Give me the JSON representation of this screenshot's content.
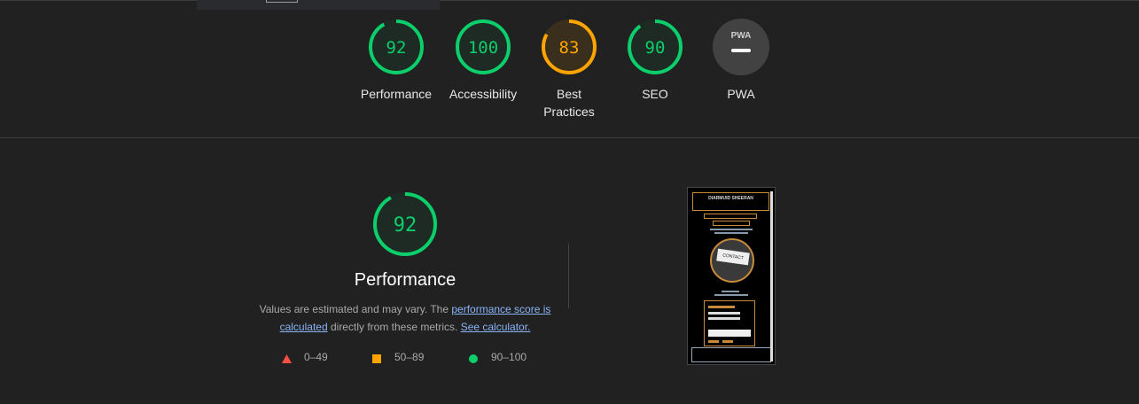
{
  "categories": [
    {
      "label": "Performance",
      "score": 92,
      "status": "pass"
    },
    {
      "label": "Accessibility",
      "score": 100,
      "status": "pass"
    },
    {
      "label": "Best Practices",
      "score": 83,
      "status": "average"
    },
    {
      "label": "SEO",
      "score": 90,
      "status": "pass"
    },
    {
      "label": "PWA",
      "score": null,
      "status": "na",
      "badge": "PWA"
    }
  ],
  "colors": {
    "pass": "#0cce6b",
    "pass_bg": "#1e2a24",
    "average": "#ffa400",
    "average_bg": "#3a2f1c",
    "fail": "#ff4e42",
    "na_bg": "#424242"
  },
  "performance": {
    "score": 92,
    "title": "Performance",
    "desc_prefix": "Values are estimated and may vary. The ",
    "link1": "performance score is calculated",
    "desc_middle": " directly from these metrics. ",
    "link2": "See calculator."
  },
  "legend": {
    "fail": "0–49",
    "average": "50–89",
    "pass": "90–100"
  },
  "screenshot": {
    "site_title": "DIARMUID SHEERAN",
    "card_text": "CONTACT"
  }
}
